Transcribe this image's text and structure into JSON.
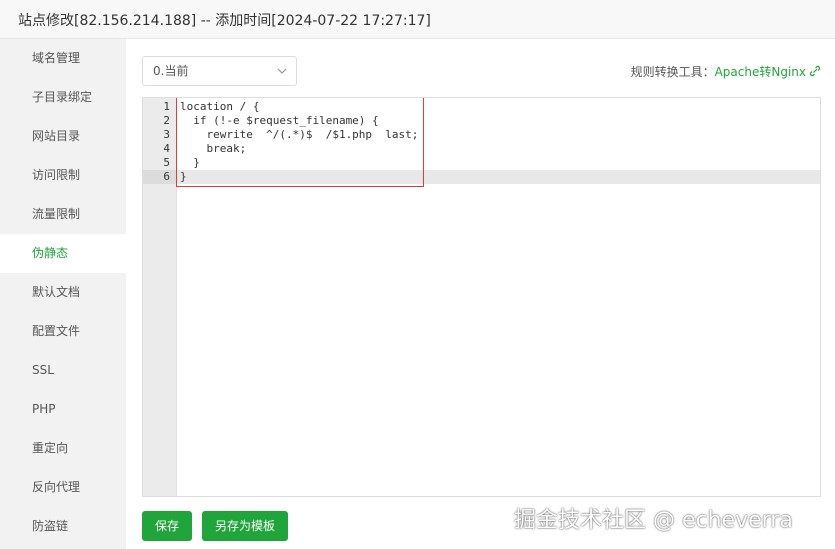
{
  "window": {
    "title": "站点修改[82.156.214.188] -- 添加时间[2024-07-22 17:27:17]"
  },
  "sidebar": {
    "items": [
      {
        "label": "域名管理"
      },
      {
        "label": "子目录绑定"
      },
      {
        "label": "网站目录"
      },
      {
        "label": "访问限制"
      },
      {
        "label": "流量限制"
      },
      {
        "label": "伪静态",
        "active": true
      },
      {
        "label": "默认文档"
      },
      {
        "label": "配置文件"
      },
      {
        "label": "SSL"
      },
      {
        "label": "PHP"
      },
      {
        "label": "重定向"
      },
      {
        "label": "反向代理"
      },
      {
        "label": "防盗链"
      }
    ]
  },
  "toolbar": {
    "template_select": "0.当前",
    "tool_label": "规则转换工具：",
    "tool_link": "Apache转Nginx"
  },
  "editor": {
    "line_numbers": [
      "1",
      "2",
      "3",
      "4",
      "5",
      "6"
    ],
    "lines": [
      "location / {",
      "  if (!-e $request_filename) {",
      "    rewrite  ^/(.*)$  /$1.php  last;",
      "    break;",
      "  }",
      "}"
    ],
    "current_line": 6
  },
  "buttons": {
    "save": "保存",
    "save_as_template": "另存为模板"
  },
  "watermark": "掘金技术社区 @ echeverra",
  "colors": {
    "accent": "#20a53a",
    "highlight_box": "#e03c3c"
  }
}
